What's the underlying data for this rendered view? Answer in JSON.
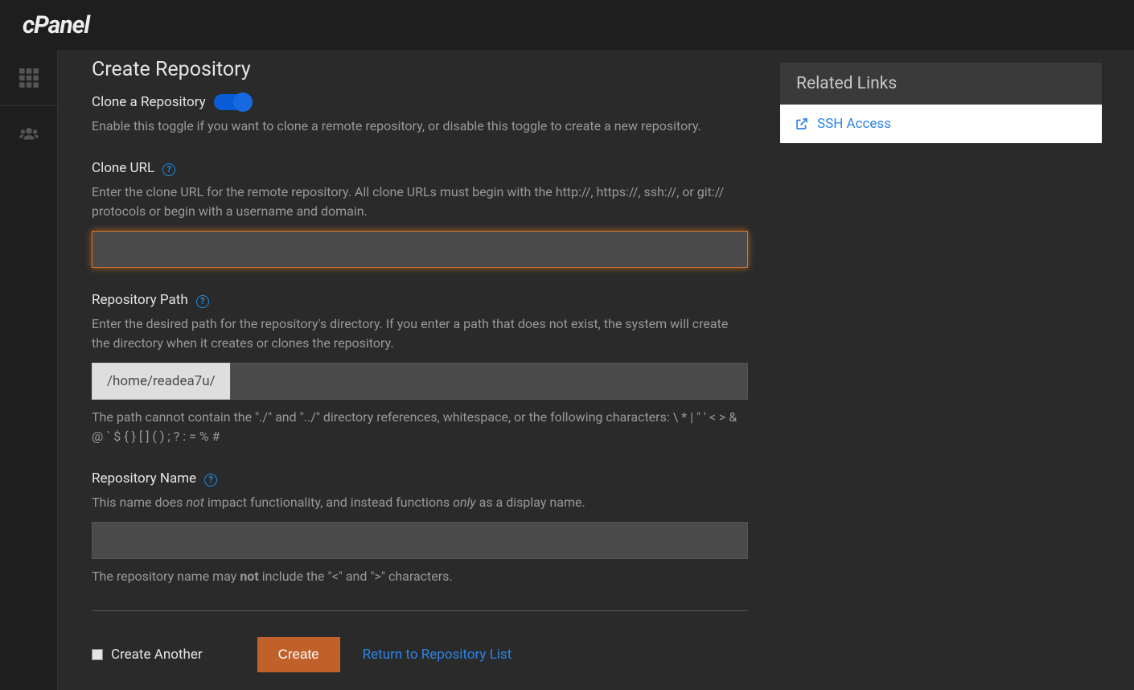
{
  "header": {
    "logo": "cPanel"
  },
  "rail": {
    "items": [
      "apps-grid",
      "users"
    ]
  },
  "page": {
    "title": "Create Repository"
  },
  "clone_toggle": {
    "label": "Clone a Repository",
    "description": "Enable this toggle if you want to clone a remote repository, or disable this toggle to create a new repository."
  },
  "clone_url": {
    "label": "Clone URL",
    "description": "Enter the clone URL for the remote repository. All clone URLs must begin with the http://, https://, ssh://, or git:// protocols or begin with a username and domain.",
    "value": ""
  },
  "repo_path": {
    "label": "Repository Path",
    "description": "Enter the desired path for the repository's directory. If you enter a path that does not exist, the system will create the directory when it creates or clones the repository.",
    "prefix": "/home/readea7u/",
    "value": "",
    "post_pre": "The path cannot contain the \"./\" and \"../\" directory references, whitespace, or the following characters: ",
    "post_chars": "\\ * | \" ' < > & @ ` $ { } [ ] ( ) ; ? : = % #"
  },
  "repo_name": {
    "label": "Repository Name",
    "desc_pre": "This name does ",
    "desc_em1": "not",
    "desc_mid": " impact functionality, and instead functions ",
    "desc_em2": "only",
    "desc_end": " as a display name.",
    "value": "",
    "post_pre": "The repository name may ",
    "post_strong": "not",
    "post_end": " include the \"<\" and \">\" characters."
  },
  "actions": {
    "create_another": "Create Another",
    "create": "Create",
    "return": "Return to Repository List"
  },
  "sidebar": {
    "title": "Related Links",
    "items": [
      {
        "label": "SSH Access"
      }
    ]
  }
}
